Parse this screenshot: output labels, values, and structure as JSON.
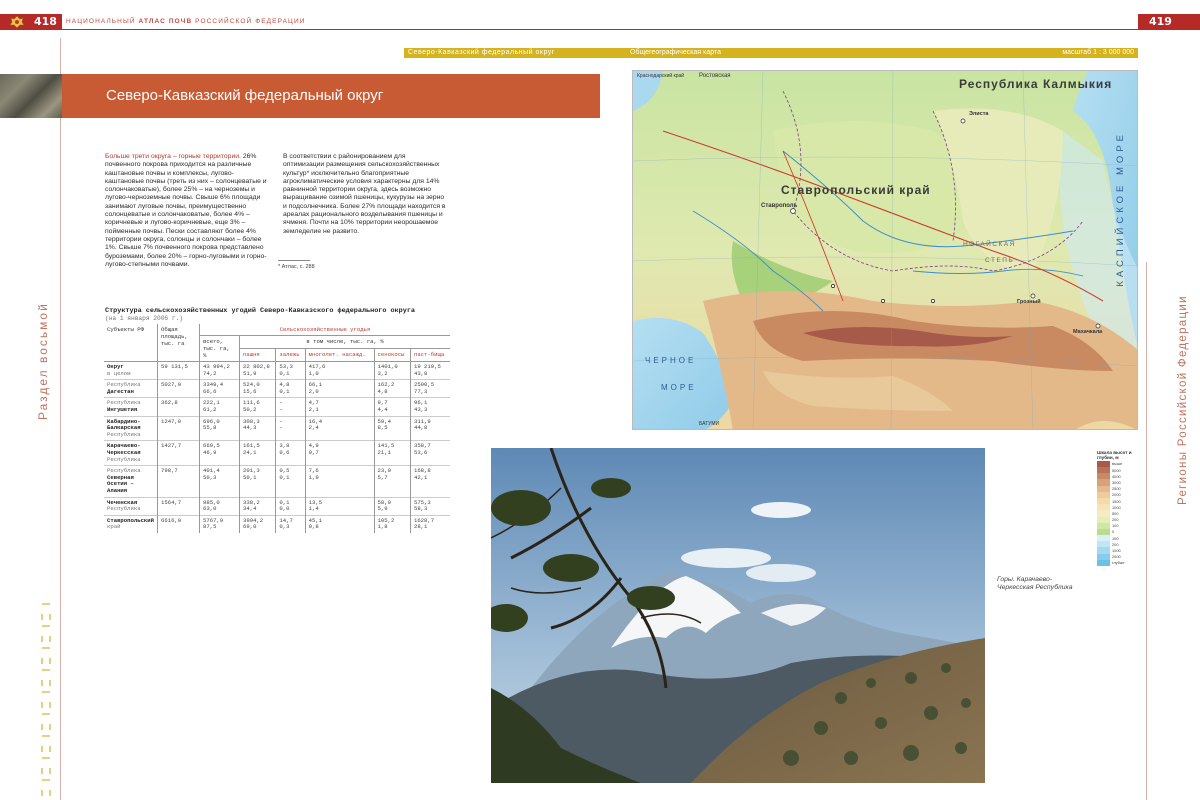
{
  "header": {
    "left_page_number": "418",
    "right_page_number": "419",
    "running_head_prefix": "национальный",
    "running_head_bold": "атлас почв",
    "running_head_suffix": "российской федерации",
    "brand_color": "#b52a26"
  },
  "left_page": {
    "section_label": "Раздел восьмой",
    "title": "Северо-Кавказский федеральный округ",
    "title_bar_color": "#c85a34",
    "col1_lead": "Больше трети округа – горные территории.",
    "col1_body": "26% почвенного покрова приходится на различные каштановые почвы и комплексы, лугово-каштановые почвы (треть из них – солонцеватые и солончаковатые), более 25% – на черноземы и лугово-черноземные почвы. Свыше 6% площади занимают луговые почвы, преимущественно солонцеватые и солончаковатые, более 4% – коричневые и лугово-коричневые, еще 3% – пойменные почвы. Пески составляют более 4% территории округа, солонцы и солончаки – более 1%. Свыше 7% почвенного покрова представлено буроземами, более 20% – горно-луговыми и горно-лугово-степными почвами.",
    "col2_body": "В соответствии с районированием для оптимизации размещения сельскохозяйственных культур* исключительно благоприятные агроклиматические условия характерны для 14% равнинной территории округа, здесь возможно выращивание озимой пшеницы, кукурузы на зерно и подсолнечника. Более 27% площади находится в ареалах рационального возделывания пшеницы и ячменя. Почти на 10% территории неорошаемое земледелие не развито.",
    "footnote": "*  Атлас, с. 288"
  },
  "table": {
    "caption": "Структура сельскохозяйственных угодий Северо-Кавказского федерального округа",
    "subcaption": "(на 1 января 2006 г.)",
    "headers": {
      "subject": "Субъекты РФ",
      "area": "Общая площадь, тыс. га",
      "agri_group": "Сельскохозяйственные угодья",
      "total": "всего, тыс. га, %",
      "incl": "в том числе, тыс. га, %",
      "arable": "пашня",
      "fallow": "залежь",
      "perennial": "многолет. насажд.",
      "hay": "сенокосы",
      "pasture": "паст-бища"
    },
    "rows": [
      {
        "name_bold": "Округ",
        "name_sub": "в целом",
        "area": "59 131,5",
        "total": "43 994,2",
        "total_pct": "74,2",
        "arable": "22 802,8",
        "arable_pct": "51,9",
        "fallow": "53,3",
        "fallow_pct": "0,1",
        "perennial": "417,6",
        "perennial_pct": "1,0",
        "hay": "1401,0",
        "hay_pct": "3,2",
        "pasture": "19 219,5",
        "pasture_pct": "43,8"
      },
      {
        "name_pre": "Республика",
        "name_bold": "Дагестан",
        "area": "5027,0",
        "total": "3349,4",
        "total_pct": "66,6",
        "arable": "524,0",
        "arable_pct": "15,6",
        "fallow": "4,8",
        "fallow_pct": "0,1",
        "perennial": "66,1",
        "perennial_pct": "2,0",
        "hay": "162,2",
        "hay_pct": "4,8",
        "pasture": "2590,5",
        "pasture_pct": "77,3"
      },
      {
        "name_pre": "Республика",
        "name_bold": "Ингушетия",
        "area": "362,8",
        "total": "222,1",
        "total_pct": "61,2",
        "arable": "111,6",
        "arable_pct": "50,2",
        "fallow": "–",
        "fallow_pct": "–",
        "perennial": "4,7",
        "perennial_pct": "2,1",
        "hay": "9,7",
        "hay_pct": "4,4",
        "pasture": "96,1",
        "pasture_pct": "43,3"
      },
      {
        "name_bold": "Кабардино-Балкарская",
        "name_sub": "Республика",
        "area": "1247,0",
        "total": "696,0",
        "total_pct": "55,8",
        "arable": "308,3",
        "arable_pct": "44,3",
        "fallow": "–",
        "fallow_pct": "–",
        "perennial": "16,4",
        "perennial_pct": "2,4",
        "hay": "59,4",
        "hay_pct": "8,5",
        "pasture": "311,9",
        "pasture_pct": "44,8"
      },
      {
        "name_bold": "Карачаево-Черкесская",
        "name_sub": "Республика",
        "area": "1427,7",
        "total": "669,5",
        "total_pct": "46,9",
        "arable": "161,5",
        "arable_pct": "24,1",
        "fallow": "3,8",
        "fallow_pct": "0,6",
        "perennial": "4,9",
        "perennial_pct": "0,7",
        "hay": "141,5",
        "hay_pct": "21,1",
        "pasture": "358,7",
        "pasture_pct": "53,6"
      },
      {
        "name_pre": "Республика",
        "name_bold": "Северная Осетия – Алания",
        "area": "798,7",
        "total": "401,4",
        "total_pct": "50,3",
        "arable": "201,3",
        "arable_pct": "50,1",
        "fallow": "0,5",
        "fallow_pct": "0,1",
        "perennial": "7,6",
        "perennial_pct": "1,9",
        "hay": "23,0",
        "hay_pct": "5,7",
        "pasture": "168,8",
        "pasture_pct": "42,1"
      },
      {
        "name_bold": "Чеченская",
        "name_sub": "Республика",
        "area": "1564,7",
        "total": "985,0",
        "total_pct": "63,0",
        "arable": "338,2",
        "arable_pct": "34,4",
        "fallow": "0,1",
        "fallow_pct": "0,0",
        "perennial": "13,5",
        "perennial_pct": "1,4",
        "hay": "58,9",
        "hay_pct": "5,9",
        "pasture": "575,3",
        "pasture_pct": "58,3"
      },
      {
        "name_bold": "Ставропольский",
        "name_sub": "край",
        "area": "6616,0",
        "total": "5767,9",
        "total_pct": "87,5",
        "arable": "3994,2",
        "arable_pct": "69,0",
        "fallow": "14,7",
        "fallow_pct": "0,3",
        "perennial": "45,1",
        "perennial_pct": "0,8",
        "hay": "105,2",
        "hay_pct": "1,8",
        "pasture": "1628,7",
        "pasture_pct": "28,1"
      }
    ]
  },
  "right_page": {
    "map_header_title": "Северо-Кавказский федеральный округ",
    "map_header_type": "Общегеографическая карта",
    "map_header_scale": "масштаб 1 : 3 000 000",
    "map_header_color": "#d5b31e",
    "section_label": "Регионы Российской Федерации",
    "photo_caption": "Горы. Карачаево-Черкесская Республика"
  },
  "map": {
    "labels": {
      "kalmykia": "Республика Калмыкия",
      "stavropol": "Ставропольский край",
      "stavropol_city": "Ставрополь",
      "caspian": "КАСПИЙСКОЕ МОРЕ",
      "black_sea_1": "ЧЕРНОЕ",
      "black_sea_2": "МОРЕ",
      "rostov": "Ростовская",
      "nogai": "НОГАЙСКАЯ",
      "steppe": "СТЕПЬ",
      "grozny": "Грозный",
      "makhachkala": "Махачкала",
      "elista": "Элиста",
      "top_left": "Краснодарский край",
      "batumi": "БАТУМИ"
    }
  },
  "legend": {
    "title": "Шкала высот и глубин, м",
    "levels": [
      {
        "label": "выше",
        "color": "#a65b4a"
      },
      {
        "label": "5000",
        "color": "#b9725a"
      },
      {
        "label": "4000",
        "color": "#c98867"
      },
      {
        "label": "3000",
        "color": "#d9a07a"
      },
      {
        "label": "2500",
        "color": "#e6b88e"
      },
      {
        "label": "2000",
        "color": "#eecb9e"
      },
      {
        "label": "1500",
        "color": "#f3d9ac"
      },
      {
        "label": "1000",
        "color": "#f6e4b7"
      },
      {
        "label": "500",
        "color": "#f3edc0"
      },
      {
        "label": "200",
        "color": "#e4efb8"
      },
      {
        "label": "100",
        "color": "#cfe6a4"
      },
      {
        "label": "0",
        "color": "#b7dc92"
      },
      {
        "label": "100",
        "color": "#d8f0f6"
      },
      {
        "label": "200",
        "color": "#bfe6f4"
      },
      {
        "label": "1000",
        "color": "#a3daf0"
      },
      {
        "label": "2000",
        "color": "#86cdec"
      },
      {
        "label": "глубже",
        "color": "#6cc0e6"
      }
    ]
  }
}
